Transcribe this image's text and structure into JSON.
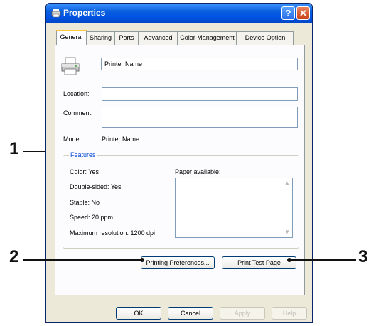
{
  "window": {
    "title": "Properties",
    "help_glyph": "?",
    "close_glyph": "✕"
  },
  "tabs": [
    {
      "label": "General",
      "active": true
    },
    {
      "label": "Sharing"
    },
    {
      "label": "Ports"
    },
    {
      "label": "Advanced"
    },
    {
      "label": "Color Management"
    },
    {
      "label": "Device Option"
    }
  ],
  "general": {
    "printer_name_value": "Printer Name",
    "location_label": "Location:",
    "location_value": "",
    "comment_label": "Comment:",
    "comment_value": "",
    "model_label": "Model:",
    "model_value": "Printer Name"
  },
  "features": {
    "title": "Features",
    "color": "Color: Yes",
    "double_sided": "Double-sided: Yes",
    "staple": "Staple: No",
    "speed": "Speed: 20 ppm",
    "max_resolution": "Maximum resolution: 1200 dpi",
    "paper_available_label": "Paper available:",
    "paper_list": []
  },
  "buttons": {
    "printing_preferences": "Printing Preferences...",
    "print_test_page": "Print Test Page",
    "ok": "OK",
    "cancel": "Cancel",
    "apply": "Apply",
    "help": "Help"
  },
  "callouts": {
    "one": "1",
    "two": "2",
    "three": "3"
  },
  "colors": {
    "titlebar": "#0054e3",
    "dialog_bg": "#ece9d8",
    "active_tab_accent": "#ffc83c",
    "group_title": "#0046d5"
  },
  "icons": {
    "title": "printer-icon",
    "printer": "printer-icon",
    "help": "help-icon",
    "close": "close-icon"
  }
}
